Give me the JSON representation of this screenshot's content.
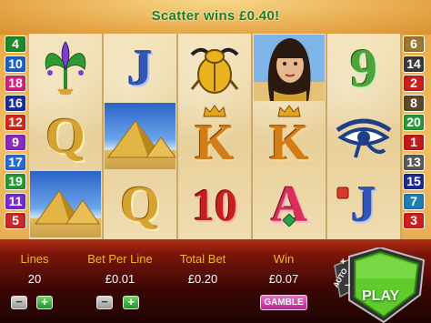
{
  "message": {
    "scatter": "Scatter wins £0.40!"
  },
  "paylines": {
    "left": [
      {
        "n": "4",
        "color": "#1f8b2c"
      },
      {
        "n": "10",
        "color": "#1c63c8"
      },
      {
        "n": "18",
        "color": "#d6247a"
      },
      {
        "n": "16",
        "color": "#1c2f9e"
      },
      {
        "n": "12",
        "color": "#d9281c"
      },
      {
        "n": "9",
        "color": "#8a2bbd"
      },
      {
        "n": "17",
        "color": "#2a6bd8"
      },
      {
        "n": "19",
        "color": "#2a9a35"
      },
      {
        "n": "11",
        "color": "#7b2ad0"
      },
      {
        "n": "5",
        "color": "#c92a2a"
      }
    ],
    "right": [
      {
        "n": "6",
        "color": "#9d7a34"
      },
      {
        "n": "14",
        "color": "#3b3b3b"
      },
      {
        "n": "2",
        "color": "#cc1e1e"
      },
      {
        "n": "8",
        "color": "#5e4a2a"
      },
      {
        "n": "20",
        "color": "#2a9b3a"
      },
      {
        "n": "1",
        "color": "#c41a1a"
      },
      {
        "n": "13",
        "color": "#5c5c5c"
      },
      {
        "n": "15",
        "color": "#1b2d90"
      },
      {
        "n": "7",
        "color": "#1e7fb5"
      },
      {
        "n": "3",
        "color": "#cf2020"
      }
    ]
  },
  "reels": {
    "r1": [
      "lotus",
      "Q",
      "pyramids"
    ],
    "r2": [
      "J",
      "pyramids",
      "Q"
    ],
    "r3": [
      "scarab",
      "K",
      "10"
    ],
    "r4": [
      "cleopatra",
      "K",
      "A"
    ],
    "r5": [
      "9",
      "eye-of-horus",
      "J"
    ]
  },
  "bet_panel": {
    "lines_label": "Lines",
    "lines_value": "20",
    "bet_per_line_label": "Bet Per Line",
    "bet_per_line_value": "£0.01",
    "total_bet_label": "Total Bet",
    "total_bet_value": "£0.20",
    "win_label": "Win",
    "win_value": "£0.07",
    "gamble_label": "GAMBLE",
    "minus": "−",
    "plus": "+"
  },
  "controls": {
    "play_label": "PLAY",
    "auto_label": "AUTO",
    "auto_minus": "−",
    "auto_plus": "+"
  }
}
